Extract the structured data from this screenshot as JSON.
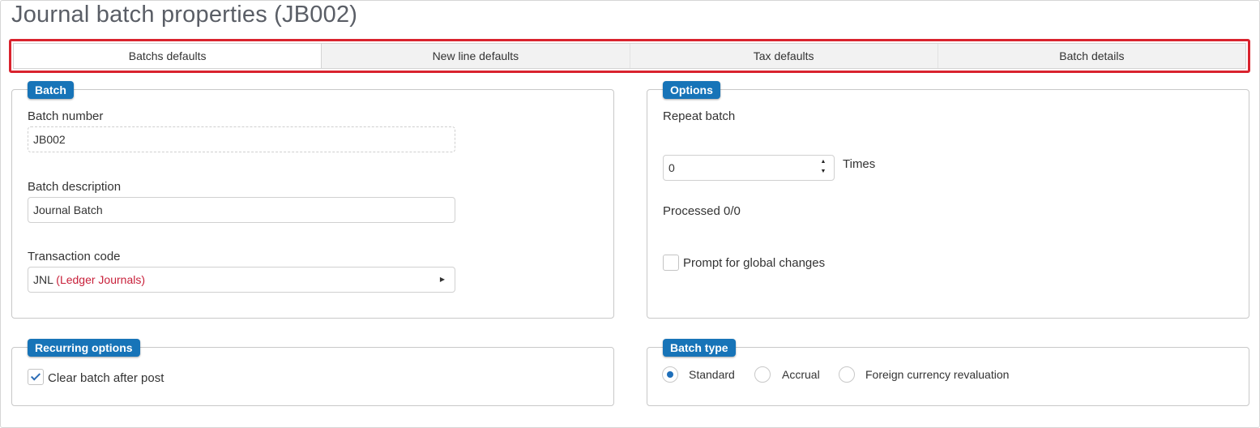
{
  "page": {
    "title": "Journal batch properties (JB002)"
  },
  "tabs": [
    {
      "label": "Batchs defaults",
      "active": true
    },
    {
      "label": "New line defaults",
      "active": false
    },
    {
      "label": "Tax defaults",
      "active": false
    },
    {
      "label": "Batch details",
      "active": false
    }
  ],
  "colors": {
    "accent": "#1774b8",
    "highlight": "#d9232e",
    "link_red": "#c8203a"
  },
  "batch": {
    "legend": "Batch",
    "number_label": "Batch number",
    "number_value": "JB002",
    "description_label": "Batch description",
    "description_value": "Journal Batch",
    "transaction_label": "Transaction code",
    "transaction_code": "JNL",
    "transaction_name": "(Ledger Journals)"
  },
  "options": {
    "legend": "Options",
    "repeat_label": "Repeat batch",
    "repeat_value": "0",
    "times_label": "Times",
    "processed": "Processed 0/0",
    "prompt_label": "Prompt for global changes",
    "prompt_checked": false
  },
  "recurring": {
    "legend": "Recurring options",
    "clear_label": "Clear batch after post",
    "clear_checked": true
  },
  "batch_type": {
    "legend": "Batch type",
    "options": [
      {
        "label": "Standard",
        "selected": true
      },
      {
        "label": "Accrual",
        "selected": false
      },
      {
        "label": "Foreign currency revaluation",
        "selected": false
      }
    ]
  }
}
